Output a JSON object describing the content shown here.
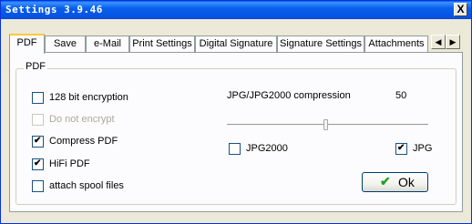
{
  "window": {
    "title": "Settings 3.9.46",
    "close_symbol": "X"
  },
  "tabs": [
    {
      "label": "PDF"
    },
    {
      "label": "Save"
    },
    {
      "label": "e-Mail"
    },
    {
      "label": "Print Settings"
    },
    {
      "label": "Digital Signature"
    },
    {
      "label": "Signature Settings"
    },
    {
      "label": "Attachments"
    }
  ],
  "tab_scroll": {
    "left_symbol": "◀",
    "right_symbol": "▶"
  },
  "group": {
    "label": "PDF"
  },
  "options": [
    {
      "label": "128 bit encryption",
      "checked": false,
      "enabled": true
    },
    {
      "label": "Do not encrypt",
      "checked": false,
      "enabled": false
    },
    {
      "label": "Compress PDF",
      "checked": true,
      "enabled": true
    },
    {
      "label": "HiFi PDF",
      "checked": true,
      "enabled": true
    },
    {
      "label": "attach spool files",
      "checked": false,
      "enabled": true
    }
  ],
  "compression": {
    "label": "JPG/JPG2000 compression",
    "value": "50"
  },
  "format_options": [
    {
      "label": "JPG2000",
      "checked": false
    },
    {
      "label": "JPG",
      "checked": true
    }
  ],
  "ok_button": {
    "label": "Ok"
  },
  "check_mark": "✔"
}
